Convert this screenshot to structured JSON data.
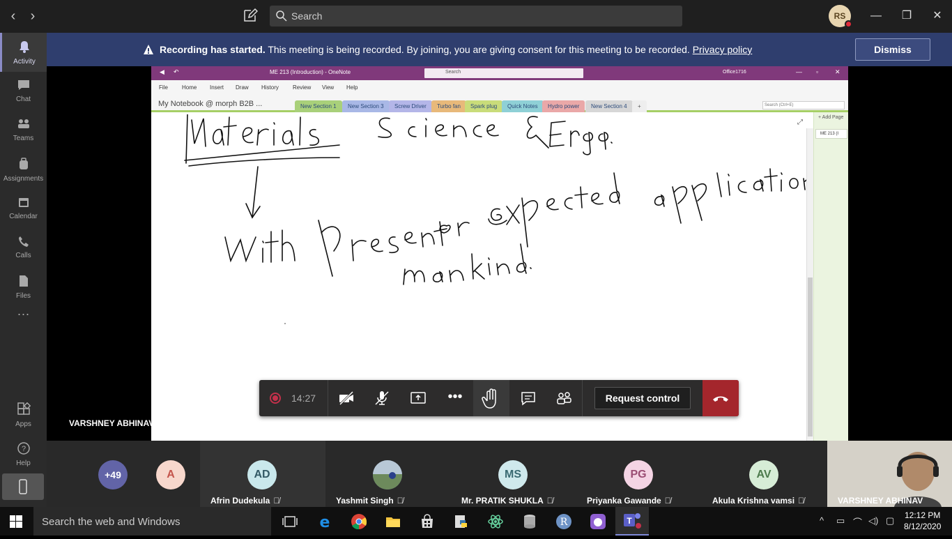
{
  "titlebar": {
    "search_placeholder": "Search",
    "avatar_initials": "RS"
  },
  "rail": {
    "items": [
      {
        "label": "Activity"
      },
      {
        "label": "Chat"
      },
      {
        "label": "Teams"
      },
      {
        "label": "Assignments"
      },
      {
        "label": "Calendar"
      },
      {
        "label": "Calls"
      },
      {
        "label": "Files"
      },
      {
        "label": "Apps"
      },
      {
        "label": "Help"
      }
    ]
  },
  "banner": {
    "title": "Recording has started.",
    "message": "This meeting is being recorded. By joining, you are giving consent for this meeting to be recorded.",
    "link": "Privacy policy",
    "dismiss": "Dismiss"
  },
  "onenote": {
    "title": "ME 213 (Introduction)  -  OneNote",
    "search": "Search",
    "account": "Office1716",
    "menu": [
      "File",
      "Home",
      "Insert",
      "Draw",
      "History",
      "Review",
      "View",
      "Help"
    ],
    "notebook": "My Notebook @ morph B2B ...",
    "sections": [
      {
        "label": "New Section 1",
        "color": "#a9d07a"
      },
      {
        "label": "New Section 3",
        "color": "#a9b8e6"
      },
      {
        "label": "Screw Driver",
        "color": "#b4b6e8"
      },
      {
        "label": "Turbo fan",
        "color": "#e8b97a"
      },
      {
        "label": "Spark plug",
        "color": "#c9dc7a"
      },
      {
        "label": "Quick Notes",
        "color": "#8fd0d6"
      },
      {
        "label": "Hydro power",
        "color": "#eaa8a8"
      },
      {
        "label": "New Section 4",
        "color": "#d7d7d7"
      }
    ],
    "search_notes": "Search (Ctrl+E)",
    "add_page": "Add Page",
    "page_title": "ME 213 (I"
  },
  "presenter": "VARSHNEY ABHINAV",
  "callbar": {
    "timer": "14:27",
    "request_control": "Request control"
  },
  "participants": [
    {
      "initials": "+49",
      "name": ""
    },
    {
      "initials": "A",
      "name": ""
    },
    {
      "initials": "AD",
      "name": "Afrin Dudekula"
    },
    {
      "initials": "",
      "name": "Yashmit Singh"
    },
    {
      "initials": "MS",
      "name": "Mr. PRATIK SHUKLA"
    },
    {
      "initials": "PG",
      "name": "Priyanka Gawande"
    },
    {
      "initials": "AV",
      "name": "Akula Krishna vamsi"
    },
    {
      "initials": "",
      "name": "VARSHNEY ABHINAV"
    }
  ],
  "taskbar": {
    "search": "Search the web and Windows",
    "time": "12:12 PM",
    "date": "8/12/2020"
  }
}
